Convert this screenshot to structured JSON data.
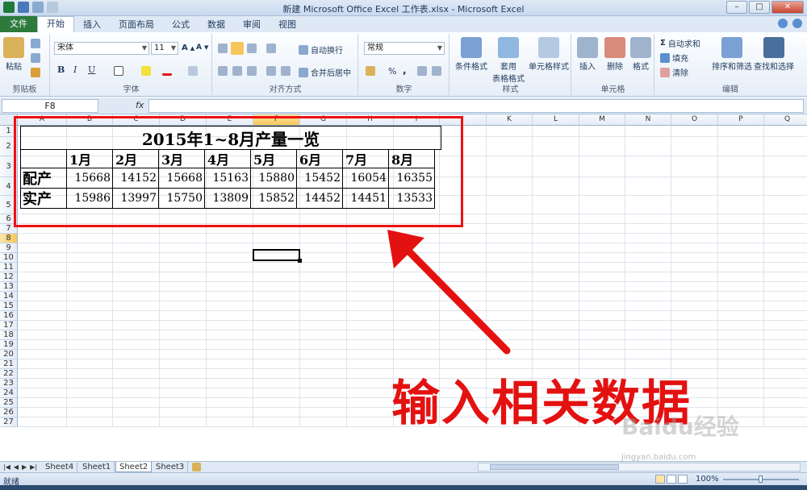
{
  "window": {
    "title": "新建 Microsoft Office Excel 工作表.xlsx - Microsoft Excel"
  },
  "ribbon_tabs": [
    {
      "label": "文件"
    },
    {
      "label": "开始"
    },
    {
      "label": "插入"
    },
    {
      "label": "页面布局"
    },
    {
      "label": "公式"
    },
    {
      "label": "数据"
    },
    {
      "label": "审阅"
    },
    {
      "label": "视图"
    }
  ],
  "ribbon": {
    "clipboard": {
      "paste": "粘贴",
      "label": "剪贴板"
    },
    "font": {
      "name": "宋体",
      "size": "11",
      "bold": "B",
      "italic": "I",
      "underline": "U",
      "label": "字体"
    },
    "alignment": {
      "wrap": "自动换行",
      "merge": "合并后居中",
      "label": "对齐方式"
    },
    "number": {
      "format": "常规",
      "percent": "%",
      "comma": ",",
      "label": "数字"
    },
    "styles": {
      "conditional": "条件格式",
      "table_line1": "套用",
      "table_line2": "表格格式",
      "cell_styles": "单元格样式",
      "label": "样式"
    },
    "cells": {
      "insert": "插入",
      "delete": "删除",
      "format": "格式",
      "label": "单元格"
    },
    "editing": {
      "autosum": "自动求和",
      "fill": "填充",
      "clear": "清除",
      "sort": "排序和筛选",
      "find": "查找和选择",
      "label": "编辑"
    }
  },
  "formula_bar": {
    "name_box": "F8",
    "fx": "fx",
    "value": ""
  },
  "columns": [
    "A",
    "B",
    "C",
    "D",
    "E",
    "F",
    "G",
    "H",
    "I",
    "J",
    "K",
    "L",
    "M",
    "N",
    "O",
    "P",
    "Q"
  ],
  "rows": [
    "1",
    "2",
    "3",
    "4",
    "5",
    "6",
    "7",
    "8",
    "9",
    "10",
    "11",
    "12",
    "13",
    "14",
    "15",
    "16",
    "17",
    "18",
    "19",
    "20",
    "21",
    "22",
    "23",
    "24",
    "25",
    "26",
    "27"
  ],
  "selected": {
    "column": "F",
    "row": "8"
  },
  "sheet_table": {
    "title": "2015年1~8月产量一览",
    "months": [
      "1月",
      "2月",
      "3月",
      "4月",
      "5月",
      "6月",
      "7月",
      "8月"
    ],
    "rows": [
      {
        "label": "配产",
        "values": [
          "15668",
          "14152",
          "15668",
          "15163",
          "15880",
          "15452",
          "16054",
          "16355"
        ]
      },
      {
        "label": "实产",
        "values": [
          "15986",
          "13997",
          "15750",
          "13809",
          "15852",
          "14452",
          "14451",
          "13533"
        ]
      }
    ]
  },
  "annotation": "输入相关数据",
  "sheets": [
    {
      "name": "Sheet4"
    },
    {
      "name": "Sheet1"
    },
    {
      "name": "Sheet2"
    },
    {
      "name": "Sheet3"
    }
  ],
  "active_sheet": "Sheet2",
  "status": {
    "text": "就绪",
    "zoom": "100%"
  },
  "watermark": {
    "main": "Baidu经验",
    "url": "jingyan.baidu.com"
  },
  "colors": {
    "file_tab": "#2d7a3c",
    "highlight": "#ee1111",
    "selected_header": "#f5c65a"
  }
}
